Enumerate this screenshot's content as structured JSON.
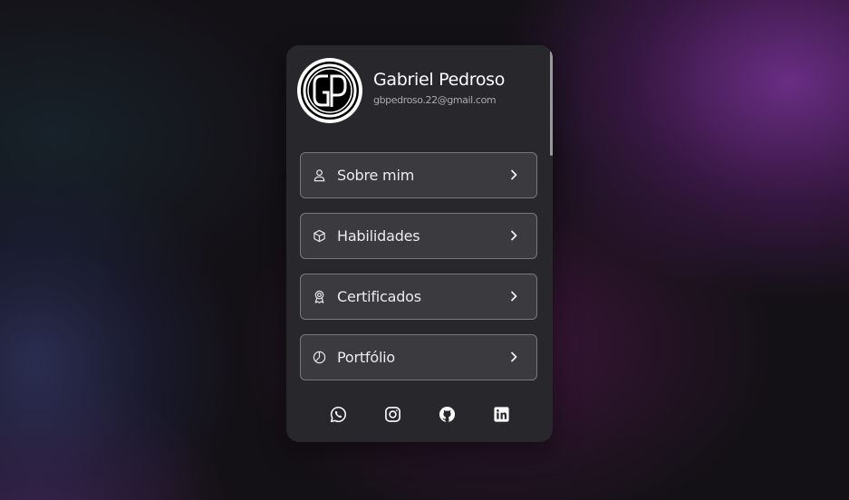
{
  "profile": {
    "name": "Gabriel Pedroso",
    "email": "gbpedroso.22@gmail.com",
    "avatar_icon": "gp-monogram-logo"
  },
  "menu": {
    "items": [
      {
        "label": "Sobre mim",
        "icon": "user-icon"
      },
      {
        "label": "Habilidades",
        "icon": "cube-icon"
      },
      {
        "label": "Certificados",
        "icon": "award-icon"
      },
      {
        "label": "Portfólio",
        "icon": "pie-chart-icon"
      }
    ],
    "chevron_icon": "chevron-right-icon"
  },
  "socials": [
    {
      "icon": "whatsapp-icon"
    },
    {
      "icon": "instagram-icon"
    },
    {
      "icon": "github-icon"
    },
    {
      "icon": "linkedin-icon"
    }
  ],
  "colors": {
    "card_bg": "#28282c",
    "button_bg": "#3b3b3f",
    "button_border": "#77777c",
    "text": "#ffffff",
    "muted_text": "#a9a9b0",
    "background_accent": "#5a2a78"
  }
}
